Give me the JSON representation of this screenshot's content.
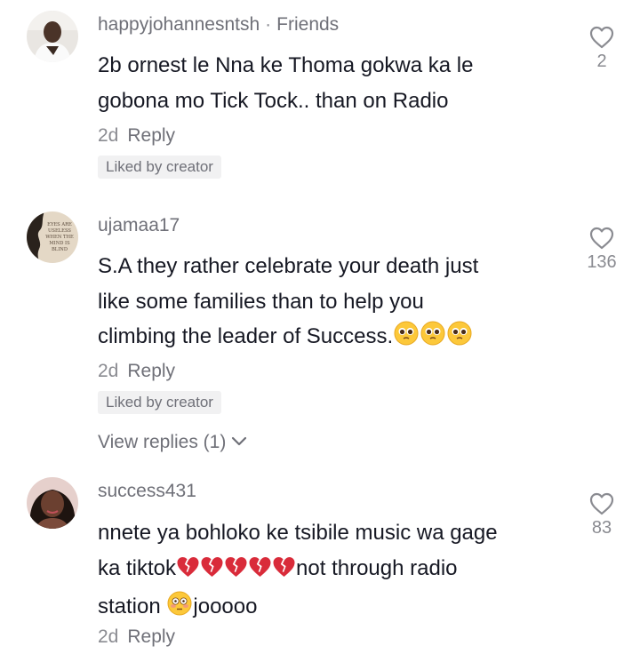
{
  "comments": [
    {
      "username": "happyjohannesntsh",
      "separator": "·",
      "badge": "Friends",
      "text_lines": [
        "2b ornest le Nna ke Thoma gokwa ka le",
        "gobona mo Tick Tock.. than on Radio"
      ],
      "time": "2d",
      "reply_label": "Reply",
      "liked_by": "Liked by creator",
      "likes": "2",
      "avatar": "person-photo"
    },
    {
      "username": "ujamaa17",
      "text_lines": [
        "S.A they rather celebrate your death just",
        "like some families than to help you",
        "climbing the leader of Success."
      ],
      "text_emojis": [
        "pleading-face-emoji",
        "pleading-face-emoji",
        "pleading-face-emoji"
      ],
      "time": "2d",
      "reply_label": "Reply",
      "liked_by": "Liked by creator",
      "view_replies": "View replies (1)",
      "likes": "136",
      "avatar": "silhouette-quote",
      "avatar_text": "EYES ARE USELESS WHEN THE MIND IS BLIND"
    },
    {
      "username": "success431",
      "text_lines": [
        "nnete ya bohloko ke tsibile music wa gage",
        "ka tiktok",
        "not through radio",
        "station ",
        "jooooo"
      ],
      "text_emojis": [
        "broken-heart-emoji",
        "broken-heart-emoji",
        "broken-heart-emoji",
        "broken-heart-emoji",
        "broken-heart-emoji",
        "flushed-face-emoji"
      ],
      "time": "2d",
      "reply_label": "Reply",
      "likes": "83",
      "avatar": "person-photo"
    }
  ],
  "colors": {
    "text": "#161823",
    "secondary": "#8a8b91",
    "username": "#6f7078",
    "badge_bg": "#f1f1f2"
  }
}
